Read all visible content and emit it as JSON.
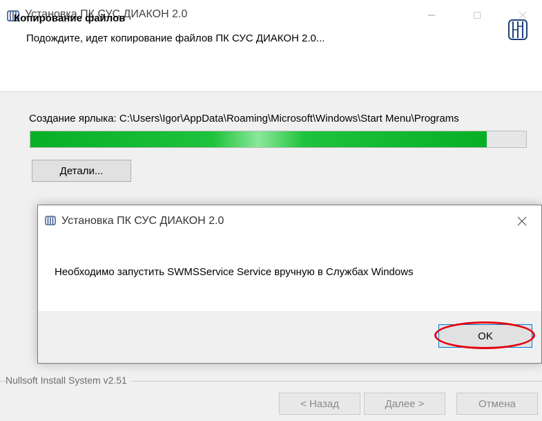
{
  "window": {
    "title": "Установка ПК СУС ДИАКОН 2.0",
    "controls": [
      "minimize-icon",
      "maximize-icon",
      "close-icon"
    ]
  },
  "header": {
    "title": "Копирование файлов",
    "subtitle": "Подождите, идет копирование файлов ПК СУС ДИАКОН 2.0..."
  },
  "install": {
    "status_text": "Создание ярлыка: C:\\Users\\Igor\\AppData\\Roaming\\Microsoft\\Windows\\Start Menu\\Programs",
    "progress_percent": 92,
    "details_button": "Детали..."
  },
  "footer": {
    "branding": "Nullsoft Install System v2.51",
    "back_button": "< Назад",
    "next_button": "Далее >",
    "cancel_button": "Отмена"
  },
  "dialog": {
    "title": "Установка ПК СУС ДИАКОН 2.0",
    "message": "Необходимо запустить SWMSService Service вручную в Службах Windows",
    "ok_button": "OK",
    "highlight_color": "#e5000c"
  },
  "colors": {
    "progress": "#06b025",
    "panel": "#f0f0f0",
    "accent": "#0078d7"
  }
}
